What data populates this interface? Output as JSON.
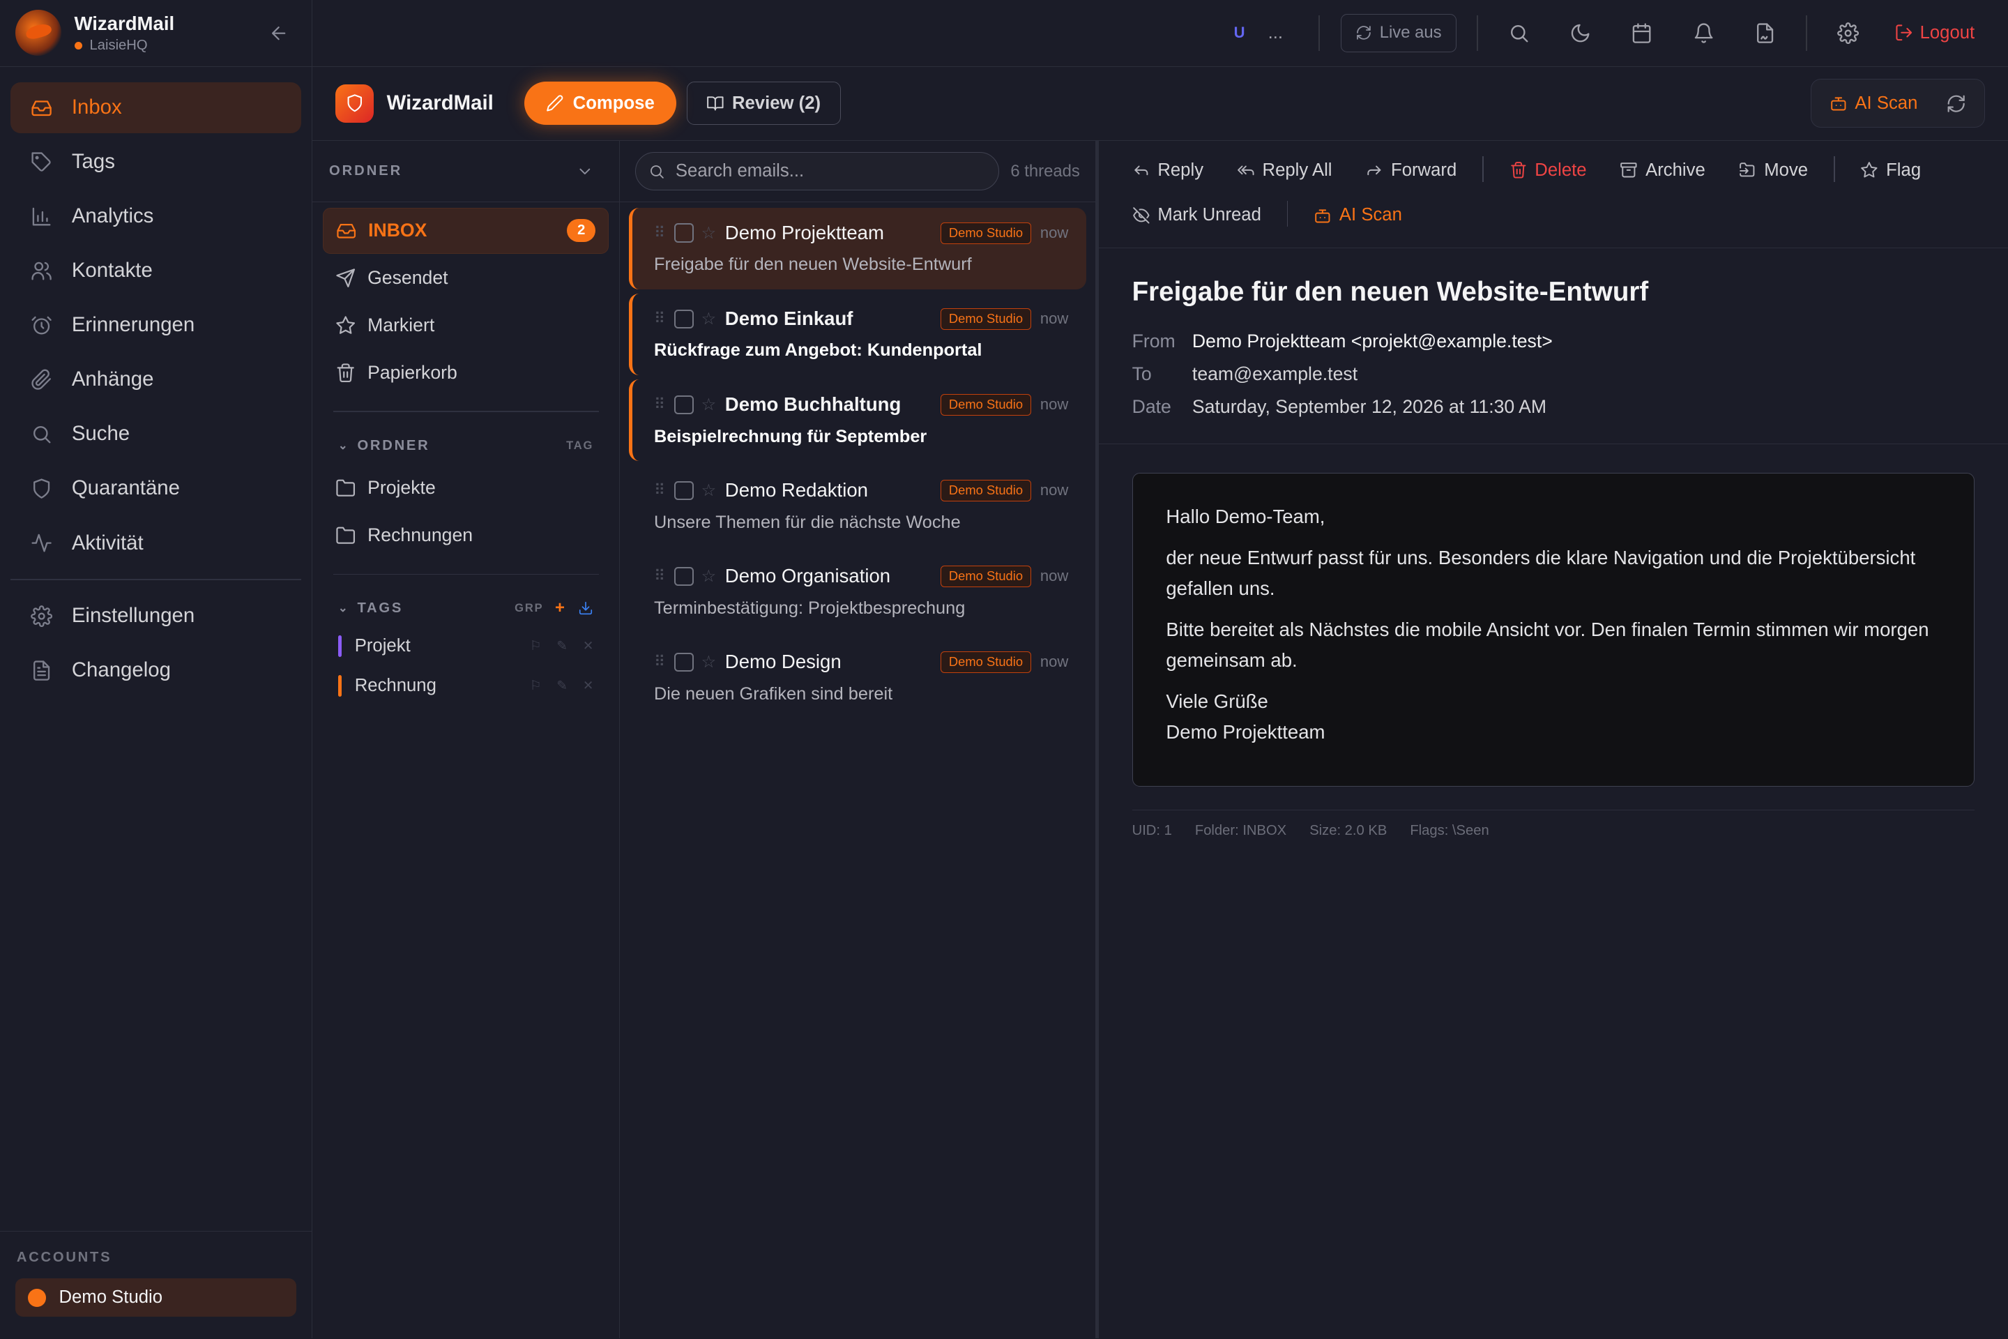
{
  "sidebar": {
    "brand": "WizardMail",
    "workspace": "LaisieHQ",
    "nav": [
      {
        "label": "Inbox",
        "icon": "inbox-icon"
      },
      {
        "label": "Tags",
        "icon": "tag-icon"
      },
      {
        "label": "Analytics",
        "icon": "bar-chart-icon"
      },
      {
        "label": "Kontakte",
        "icon": "users-icon"
      },
      {
        "label": "Erinnerungen",
        "icon": "alarm-icon"
      },
      {
        "label": "Anhänge",
        "icon": "paperclip-icon"
      },
      {
        "label": "Suche",
        "icon": "search-icon"
      },
      {
        "label": "Quarantäne",
        "icon": "shield-icon"
      },
      {
        "label": "Aktivität",
        "icon": "activity-icon"
      }
    ],
    "nav2": [
      {
        "label": "Einstellungen",
        "icon": "gear-icon"
      },
      {
        "label": "Changelog",
        "icon": "document-icon"
      }
    ],
    "accounts_title": "ACCOUNTS",
    "account": "Demo Studio"
  },
  "topbar": {
    "user_initial": "U",
    "more": "...",
    "live": "Live aus",
    "logout": "Logout"
  },
  "toolbar": {
    "app_name": "WizardMail",
    "compose": "Compose",
    "review": "Review (2)",
    "ai_scan": "AI Scan"
  },
  "folders": {
    "title": "ORDNER",
    "system": [
      {
        "label": "INBOX",
        "count": "2"
      },
      {
        "label": "Gesendet"
      },
      {
        "label": "Markiert"
      },
      {
        "label": "Papierkorb"
      }
    ],
    "custom_title": "ORDNER",
    "custom_right": "TAG",
    "custom": [
      "Projekte",
      "Rechnungen"
    ],
    "tags_title": "TAGS",
    "tags_right": "GRP",
    "tags": [
      {
        "label": "Projekt",
        "color": "#8b5cf6"
      },
      {
        "label": "Rechnung",
        "color": "#f97316"
      }
    ]
  },
  "list": {
    "search_placeholder": "Search emails...",
    "threads": "6 threads",
    "mails": [
      {
        "sender": "Demo Projektteam",
        "subject": "Freigabe für den neuen Website-Entwurf",
        "account": "Demo Studio",
        "time": "now",
        "state": "active"
      },
      {
        "sender": "Demo Einkauf",
        "subject": "Rückfrage zum Angebot: Kundenportal",
        "account": "Demo Studio",
        "time": "now",
        "state": "unread"
      },
      {
        "sender": "Demo Buchhaltung",
        "subject": "Beispielrechnung für September",
        "account": "Demo Studio",
        "time": "now",
        "state": "unread"
      },
      {
        "sender": "Demo Redaktion",
        "subject": "Unsere Themen für die nächste Woche",
        "account": "Demo Studio",
        "time": "now",
        "state": "read"
      },
      {
        "sender": "Demo Organisation",
        "subject": "Terminbestätigung: Projektbesprechung",
        "account": "Demo Studio",
        "time": "now",
        "state": "read"
      },
      {
        "sender": "Demo Design",
        "subject": "Die neuen Grafiken sind bereit",
        "account": "Demo Studio",
        "time": "now",
        "state": "read"
      }
    ]
  },
  "reader": {
    "actions": {
      "reply": "Reply",
      "reply_all": "Reply All",
      "forward": "Forward",
      "delete": "Delete",
      "archive": "Archive",
      "move": "Move",
      "flag": "Flag",
      "mark_unread": "Mark Unread",
      "ai_scan": "AI Scan"
    },
    "subject": "Freigabe für den neuen Website-Entwurf",
    "from_label": "From",
    "from": "Demo Projektteam <projekt@example.test>",
    "to_label": "To",
    "to": "team@example.test",
    "date_label": "Date",
    "date": "Saturday, September 12, 2026 at 11:30 AM",
    "body": {
      "greeting": "Hallo Demo-Team,",
      "p1": "der neue Entwurf passt für uns. Besonders die klare Navigation und die Projektübersicht gefallen uns.",
      "p2": "Bitte bereitet als Nächstes die mobile Ansicht vor. Den finalen Termin stimmen wir morgen gemeinsam ab.",
      "closing": "Viele Grüße",
      "signature": "Demo Projektteam"
    },
    "footer": {
      "uid": "UID: 1",
      "folder": "Folder: INBOX",
      "size": "Size: 2.0 KB",
      "flags": "Flags: \\Seen"
    }
  },
  "colors": {
    "accent": "#f97316",
    "danger": "#ef4444",
    "background": "#1b1c28"
  }
}
